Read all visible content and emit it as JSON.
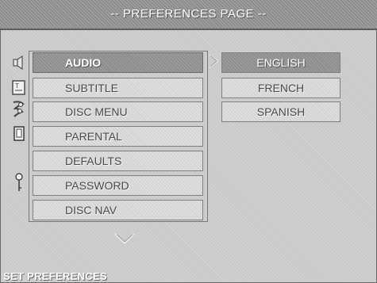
{
  "header": {
    "title": "-- PREFERENCES PAGE --"
  },
  "side_icons": [
    {
      "icon": "speaker-icon"
    },
    {
      "icon": "subtitle-icon"
    },
    {
      "icon": "disc-menu-icon"
    },
    {
      "icon": "parental-lock-icon"
    },
    {
      "icon": "key-icon"
    }
  ],
  "menu": {
    "items": [
      {
        "label": "AUDIO",
        "selected": true
      },
      {
        "label": "SUBTITLE"
      },
      {
        "label": "DISC MENU"
      },
      {
        "label": "PARENTAL"
      },
      {
        "label": "DEFAULTS"
      },
      {
        "label": "PASSWORD"
      },
      {
        "label": "DISC NAV"
      }
    ]
  },
  "submenu": {
    "items": [
      {
        "label": "ENGLISH",
        "selected": true
      },
      {
        "label": "FRENCH"
      },
      {
        "label": "SPANISH"
      }
    ]
  },
  "status": {
    "text": "SET PREFERENCES"
  },
  "colors": {
    "background": "#c9c9c9",
    "highlight": "#8e8e8e",
    "text": "#4a4a4a",
    "highlight_text": "#ffffff"
  }
}
